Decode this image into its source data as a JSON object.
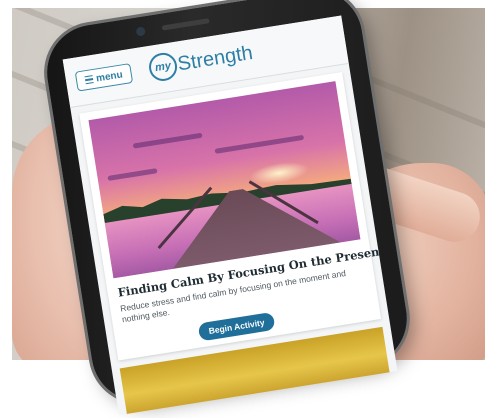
{
  "header": {
    "menu_label": "menu",
    "logo_prefix": "my",
    "logo_word": "Strength"
  },
  "card": {
    "title": "Finding Calm By Focusing On the Present",
    "description": "Reduce stress and find calm by focusing on the moment and nothing else.",
    "button_label": "Begin Activity"
  },
  "colors": {
    "brand": "#2d7fa6",
    "button": "#1f6f9a"
  },
  "icons": [
    "hamburger-menu-icon"
  ]
}
